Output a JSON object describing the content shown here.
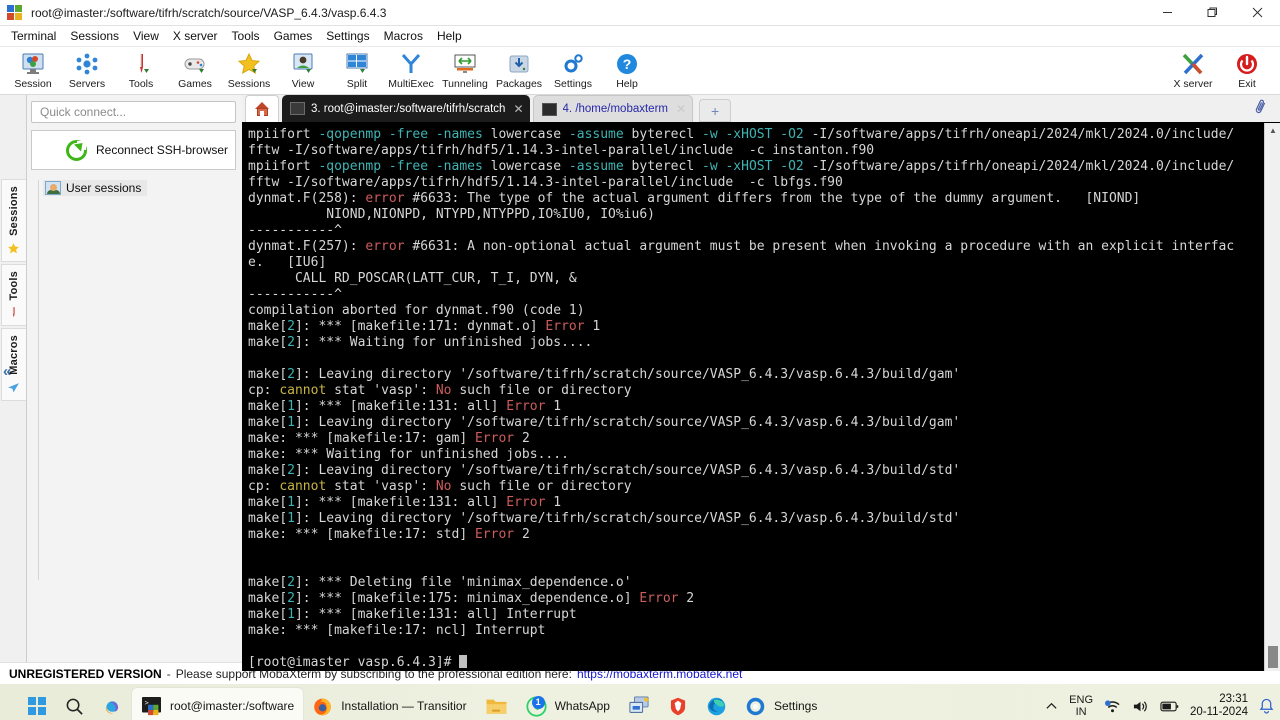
{
  "window": {
    "title": "root@imaster:/software/tifrh/scratch/source/VASP_6.4.3/vasp.6.4.3",
    "minimize": "—",
    "maximize": "❐",
    "close": "✕"
  },
  "menubar": {
    "items": [
      "Terminal",
      "Sessions",
      "View",
      "X server",
      "Tools",
      "Games",
      "Settings",
      "Macros",
      "Help"
    ]
  },
  "toolbar": {
    "buttons": [
      {
        "label": "Session",
        "icon": "session-icon"
      },
      {
        "label": "Servers",
        "icon": "servers-icon"
      },
      {
        "label": "Tools",
        "icon": "tools-icon"
      },
      {
        "label": "Games",
        "icon": "games-icon"
      },
      {
        "label": "Sessions",
        "icon": "sessions-star-icon"
      },
      {
        "label": "View",
        "icon": "view-icon"
      },
      {
        "label": "Split",
        "icon": "split-icon"
      },
      {
        "label": "MultiExec",
        "icon": "multiexec-icon"
      },
      {
        "label": "Tunneling",
        "icon": "tunneling-icon"
      },
      {
        "label": "Packages",
        "icon": "packages-icon"
      },
      {
        "label": "Settings",
        "icon": "settings-gear-icon"
      },
      {
        "label": "Help",
        "icon": "help-question-icon"
      }
    ],
    "right_buttons": [
      {
        "label": "X server",
        "icon": "x-server-icon"
      },
      {
        "label": "Exit",
        "icon": "power-exit-icon"
      }
    ]
  },
  "sidebar": {
    "quick_connect_placeholder": "Quick connect...",
    "reconnect_label": "Reconnect SSH-browser",
    "tree_item": "User sessions",
    "vertical_tabs": [
      {
        "label": "Sessions",
        "icon": "star-icon"
      },
      {
        "label": "Tools",
        "icon": "wrench-icon"
      },
      {
        "label": "Macros",
        "icon": "paper-plane-icon"
      }
    ],
    "collapse_icon": "«"
  },
  "tabs": {
    "home_icon": "home-icon",
    "items": [
      {
        "label": "3. root@imaster:/software/tifrh/scratch",
        "active": true,
        "close": "✕"
      },
      {
        "label": "4. /home/mobaxterm",
        "active": false,
        "close": "✕"
      }
    ],
    "new_tab": "+",
    "attach_icon": "paperclip-icon"
  },
  "terminal": {
    "prompt": "[root@imaster vasp.6.4.3]# ",
    "lines": [
      [
        {
          "t": "mpiifort ",
          "c": "w"
        },
        {
          "t": "-qopenmp -free -names",
          "c": "c"
        },
        {
          "t": " lowercase ",
          "c": "w"
        },
        {
          "t": "-assume",
          "c": "c"
        },
        {
          "t": " byterecl ",
          "c": "w"
        },
        {
          "t": "-w -xHOST -O2",
          "c": "c"
        },
        {
          "t": " -I/software/apps/tifrh/oneapi/2024/mkl/2024.0/include/",
          "c": "w"
        }
      ],
      [
        {
          "t": "fftw -I/software/apps/tifrh/hdf5/1.14.3-intel-parallel/include  -c instanton.f90",
          "c": "w"
        }
      ],
      [
        {
          "t": "mpiifort ",
          "c": "w"
        },
        {
          "t": "-qopenmp -free -names",
          "c": "c"
        },
        {
          "t": " lowercase ",
          "c": "w"
        },
        {
          "t": "-assume",
          "c": "c"
        },
        {
          "t": " byterecl ",
          "c": "w"
        },
        {
          "t": "-w -xHOST -O2",
          "c": "c"
        },
        {
          "t": " -I/software/apps/tifrh/oneapi/2024/mkl/2024.0/include/",
          "c": "w"
        }
      ],
      [
        {
          "t": "fftw -I/software/apps/tifrh/hdf5/1.14.3-intel-parallel/include  -c lbfgs.f90",
          "c": "w"
        }
      ],
      [
        {
          "t": "dynmat.F(258): ",
          "c": "w"
        },
        {
          "t": "error",
          "c": "r"
        },
        {
          "t": " #6633: The type of the actual argument differs from the type of the dummy argument.   [NIOND]",
          "c": "w"
        }
      ],
      [
        {
          "t": "          NIOND,NIONPD, NTYPD,NTYPPD,IO%IU0, IO%iu6)",
          "c": "w"
        }
      ],
      [
        {
          "t": "-----------^",
          "c": "w"
        }
      ],
      [
        {
          "t": "dynmat.F(257): ",
          "c": "w"
        },
        {
          "t": "error",
          "c": "r"
        },
        {
          "t": " #6631: A non-optional actual argument must be present when invoking a procedure with an explicit interfac",
          "c": "w"
        }
      ],
      [
        {
          "t": "e.   [IU6]",
          "c": "w"
        }
      ],
      [
        {
          "t": "      CALL RD_POSCAR(LATT_CUR, T_I, DYN, &",
          "c": "w"
        }
      ],
      [
        {
          "t": "-----------^",
          "c": "w"
        }
      ],
      [
        {
          "t": "compilation aborted for dynmat.f90 (code 1)",
          "c": "w"
        }
      ],
      [
        {
          "t": "make",
          "c": "w"
        },
        {
          "t": "[",
          "c": "w"
        },
        {
          "t": "2",
          "c": "c"
        },
        {
          "t": "]: *** [makefile:171: dynmat.o] ",
          "c": "w"
        },
        {
          "t": "Error",
          "c": "r"
        },
        {
          "t": " 1",
          "c": "w"
        }
      ],
      [
        {
          "t": "make",
          "c": "w"
        },
        {
          "t": "[",
          "c": "w"
        },
        {
          "t": "2",
          "c": "c"
        },
        {
          "t": "]: *** Waiting for unfinished jobs....",
          "c": "w"
        }
      ],
      [
        {
          "t": "",
          "c": "w"
        }
      ],
      [
        {
          "t": "make",
          "c": "w"
        },
        {
          "t": "[",
          "c": "w"
        },
        {
          "t": "2",
          "c": "c"
        },
        {
          "t": "]: Leaving directory '/software/tifrh/scratch/source/VASP_6.4.3/vasp.6.4.3/build/gam'",
          "c": "w"
        }
      ],
      [
        {
          "t": "cp: ",
          "c": "w"
        },
        {
          "t": "cannot",
          "c": "y"
        },
        {
          "t": " stat 'vasp': ",
          "c": "w"
        },
        {
          "t": "No",
          "c": "r"
        },
        {
          "t": " such file or directory",
          "c": "w"
        }
      ],
      [
        {
          "t": "make",
          "c": "w"
        },
        {
          "t": "[",
          "c": "w"
        },
        {
          "t": "1",
          "c": "c"
        },
        {
          "t": "]: *** [makefile:131: all] ",
          "c": "w"
        },
        {
          "t": "Error",
          "c": "r"
        },
        {
          "t": " 1",
          "c": "w"
        }
      ],
      [
        {
          "t": "make",
          "c": "w"
        },
        {
          "t": "[",
          "c": "w"
        },
        {
          "t": "1",
          "c": "c"
        },
        {
          "t": "]: Leaving directory '/software/tifrh/scratch/source/VASP_6.4.3/vasp.6.4.3/build/gam'",
          "c": "w"
        }
      ],
      [
        {
          "t": "make: *** [makefile:17: gam] ",
          "c": "w"
        },
        {
          "t": "Error",
          "c": "r"
        },
        {
          "t": " 2",
          "c": "w"
        }
      ],
      [
        {
          "t": "make: *** Waiting for unfinished jobs....",
          "c": "w"
        }
      ],
      [
        {
          "t": "make",
          "c": "w"
        },
        {
          "t": "[",
          "c": "w"
        },
        {
          "t": "2",
          "c": "c"
        },
        {
          "t": "]: Leaving directory '/software/tifrh/scratch/source/VASP_6.4.3/vasp.6.4.3/build/std'",
          "c": "w"
        }
      ],
      [
        {
          "t": "cp: ",
          "c": "w"
        },
        {
          "t": "cannot",
          "c": "y"
        },
        {
          "t": " stat 'vasp': ",
          "c": "w"
        },
        {
          "t": "No",
          "c": "r"
        },
        {
          "t": " such file or directory",
          "c": "w"
        }
      ],
      [
        {
          "t": "make",
          "c": "w"
        },
        {
          "t": "[",
          "c": "w"
        },
        {
          "t": "1",
          "c": "c"
        },
        {
          "t": "]: *** [makefile:131: all] ",
          "c": "w"
        },
        {
          "t": "Error",
          "c": "r"
        },
        {
          "t": " 1",
          "c": "w"
        }
      ],
      [
        {
          "t": "make",
          "c": "w"
        },
        {
          "t": "[",
          "c": "w"
        },
        {
          "t": "1",
          "c": "c"
        },
        {
          "t": "]: Leaving directory '/software/tifrh/scratch/source/VASP_6.4.3/vasp.6.4.3/build/std'",
          "c": "w"
        }
      ],
      [
        {
          "t": "make: *** [makefile:17: std] ",
          "c": "w"
        },
        {
          "t": "Error",
          "c": "r"
        },
        {
          "t": " 2",
          "c": "w"
        }
      ],
      [
        {
          "t": "",
          "c": "w"
        }
      ],
      [
        {
          "t": "",
          "c": "w"
        }
      ],
      [
        {
          "t": "make",
          "c": "w"
        },
        {
          "t": "[",
          "c": "w"
        },
        {
          "t": "2",
          "c": "c"
        },
        {
          "t": "]: *** Deleting file 'minimax_dependence.o'",
          "c": "w"
        }
      ],
      [
        {
          "t": "make",
          "c": "w"
        },
        {
          "t": "[",
          "c": "w"
        },
        {
          "t": "2",
          "c": "c"
        },
        {
          "t": "]: *** [makefile:175: minimax_dependence.o] ",
          "c": "w"
        },
        {
          "t": "Error",
          "c": "r"
        },
        {
          "t": " 2",
          "c": "w"
        }
      ],
      [
        {
          "t": "make",
          "c": "w"
        },
        {
          "t": "[",
          "c": "w"
        },
        {
          "t": "1",
          "c": "c"
        },
        {
          "t": "]: *** [makefile:131: all] Interrupt",
          "c": "w"
        }
      ],
      [
        {
          "t": "make: *** [makefile:17: ncl] Interrupt",
          "c": "w"
        }
      ],
      [
        {
          "t": "",
          "c": "w"
        }
      ]
    ]
  },
  "status": {
    "unregistered": "UNREGISTERED VERSION",
    "dash": "-",
    "message": "Please support MobaXterm by subscribing to the professional edition here:",
    "link": "https://mobaxterm.mobatek.net"
  },
  "taskbar": {
    "start_icon": "windows-start-icon",
    "search_icon": "search-icon",
    "copilot_icon": "copilot-icon",
    "items": [
      {
        "label": "root@imaster:/software",
        "icon": "mobaxterm-icon",
        "active": true,
        "badge": null
      },
      {
        "label": "Installation — Transitior",
        "icon": "firefox-icon",
        "active": false,
        "badge": null
      },
      {
        "label": "",
        "icon": "file-explorer-icon",
        "active": false,
        "badge": null
      },
      {
        "label": "WhatsApp",
        "icon": "whatsapp-icon",
        "active": false,
        "badge": "1"
      },
      {
        "label": "",
        "icon": "remote-desktop-icon",
        "active": false,
        "badge": null
      },
      {
        "label": "",
        "icon": "brave-icon",
        "active": false,
        "badge": null
      },
      {
        "label": "",
        "icon": "edge-icon",
        "active": false,
        "badge": null
      },
      {
        "label": "Settings",
        "icon": "settings-gear-icon",
        "active": false,
        "badge": null
      }
    ],
    "tray": {
      "chevron": "⌃",
      "lang_top": "ENG",
      "lang_bottom": "IN",
      "network_icon": "wifi-icon",
      "volume_icon": "speaker-icon",
      "battery_icon": "battery-icon",
      "time": "23:31",
      "date": "20-11-2024",
      "notification_icon": "bell-icon"
    }
  },
  "colors": {
    "terminal_bg": "#000000",
    "terminal_fg": "#d6d6d6",
    "error_red": "#cd5c5c",
    "cyan": "#3fb3b3",
    "yellow": "#c8b544",
    "link_blue": "#1414d0",
    "accent_blue": "#2a6fd6"
  }
}
